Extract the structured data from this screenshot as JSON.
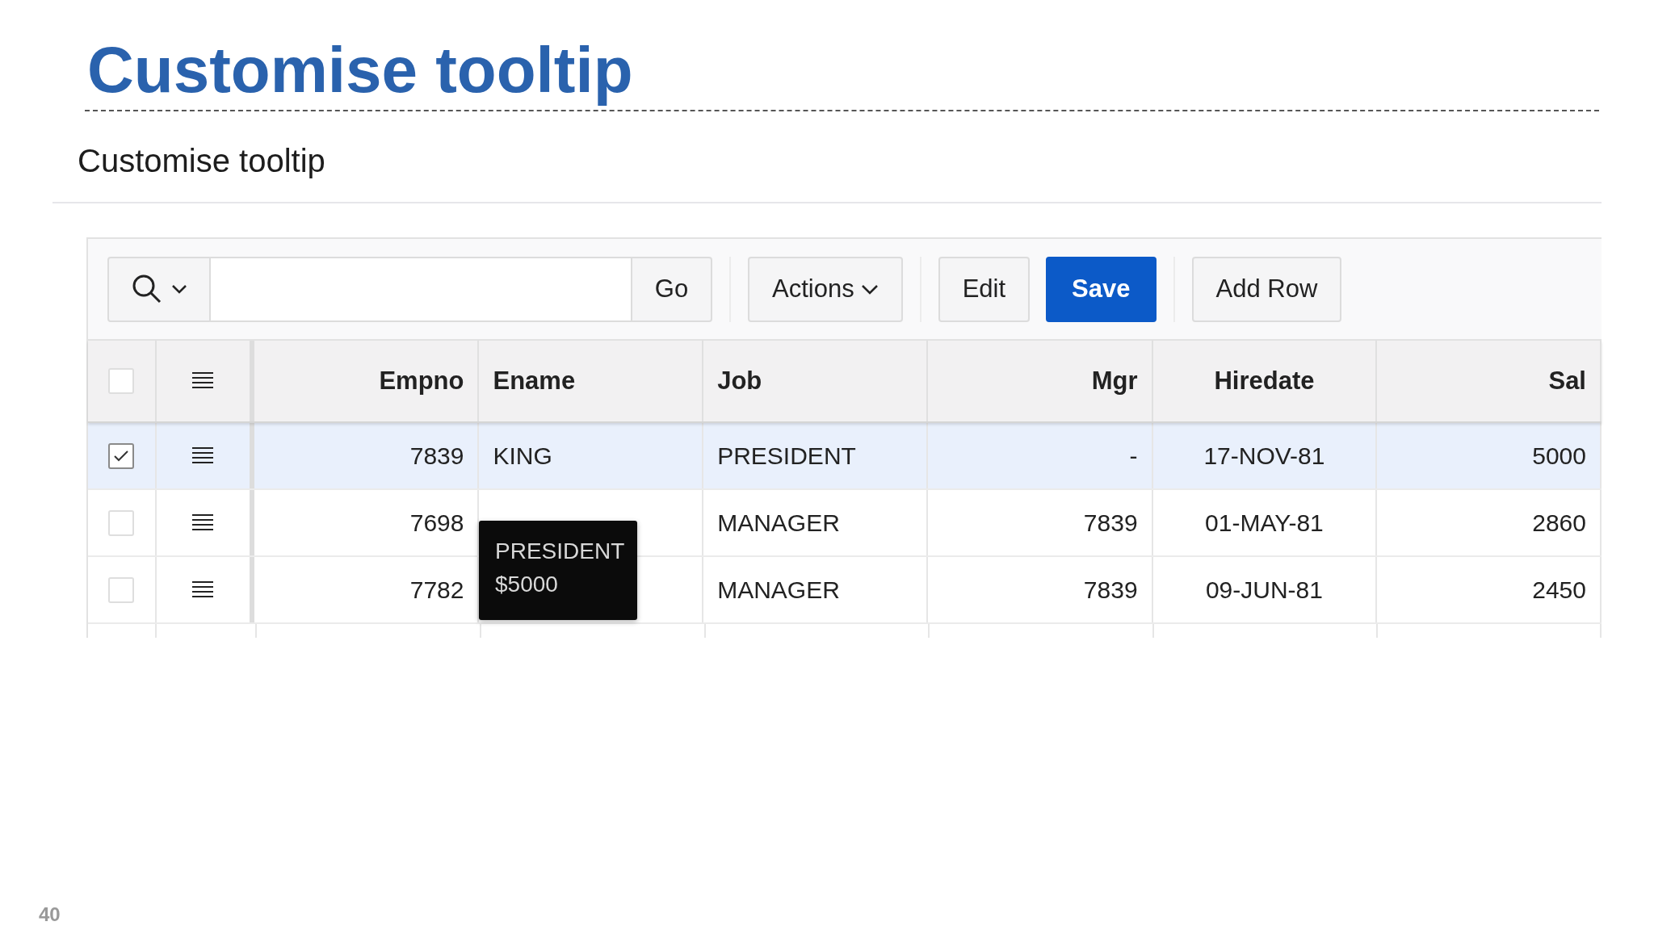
{
  "slide": {
    "title": "Customise tooltip",
    "page_number": "40"
  },
  "region": {
    "title": "Customise tooltip"
  },
  "toolbar": {
    "go": "Go",
    "button_groups": [
      [
        {
          "label": "Actions",
          "kind": "menu"
        }
      ],
      [
        {
          "label": "Edit",
          "kind": "plain"
        },
        {
          "label": "Save",
          "kind": "primary"
        }
      ],
      [
        {
          "label": "Add Row",
          "kind": "plain"
        }
      ]
    ]
  },
  "table": {
    "header_checked": false,
    "columns": [
      {
        "label": "Empno"
      },
      {
        "label": "Ename"
      },
      {
        "label": "Job"
      },
      {
        "label": "Mgr"
      },
      {
        "label": "Hiredate"
      },
      {
        "label": "Sal"
      }
    ],
    "rows": [
      {
        "selected": true,
        "checked": true,
        "cells": [
          "7839",
          "KING",
          "PRESIDENT",
          "-",
          "17-NOV-81",
          "5000"
        ]
      },
      {
        "selected": false,
        "checked": false,
        "cells": [
          "7698",
          "",
          "MANAGER",
          "7839",
          "01-MAY-81",
          "2860"
        ]
      },
      {
        "selected": false,
        "checked": false,
        "cells": [
          "7782",
          "",
          "MANAGER",
          "7839",
          "09-JUN-81",
          "2450"
        ]
      }
    ]
  },
  "tooltip": {
    "lines": [
      "PRESIDENT",
      "$5000"
    ]
  }
}
